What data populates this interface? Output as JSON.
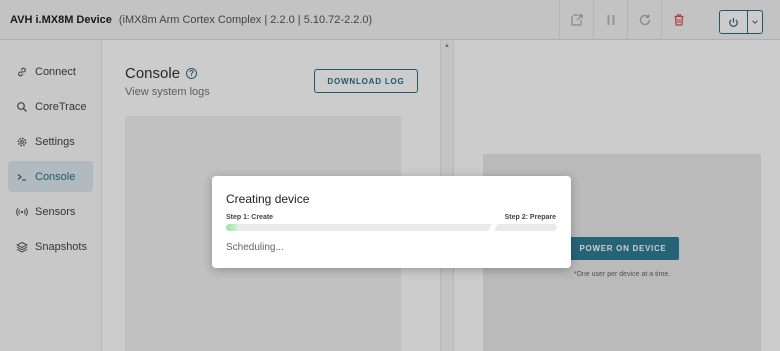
{
  "header": {
    "device_name": "AVH i.MX8M Device",
    "device_details": "(iMX8m Arm Cortex Complex | 2.2.0 | 5.10.72-2.2.0)"
  },
  "toolbar": {
    "icons": [
      "external-link-icon",
      "pause-icon",
      "refresh-icon",
      "trash-icon",
      "power-icon",
      "chevron-down-icon"
    ],
    "delete_color": "#d9534f"
  },
  "sidebar": {
    "items": [
      {
        "label": "Connect",
        "icon": "link-icon"
      },
      {
        "label": "CoreTrace",
        "icon": "search-icon"
      },
      {
        "label": "Settings",
        "icon": "gear-icon"
      },
      {
        "label": "Console",
        "icon": "terminal-icon",
        "active": true
      },
      {
        "label": "Sensors",
        "icon": "broadcast-icon"
      },
      {
        "label": "Snapshots",
        "icon": "layers-icon"
      }
    ]
  },
  "main": {
    "title": "Console",
    "subtitle": "View system logs",
    "download_label": "DOWNLOAD LOG"
  },
  "device_panel": {
    "power_on_label": "POWER ON DEVICE",
    "note": "*One user per device at a time."
  },
  "modal": {
    "title": "Creating device",
    "step1": "Step 1: Create",
    "step2": "Step 2: Prepare",
    "progress": 0.04,
    "status": "Scheduling..."
  },
  "colors": {
    "accent": "#2a6f86",
    "progress_fill": "#9be2a3"
  }
}
